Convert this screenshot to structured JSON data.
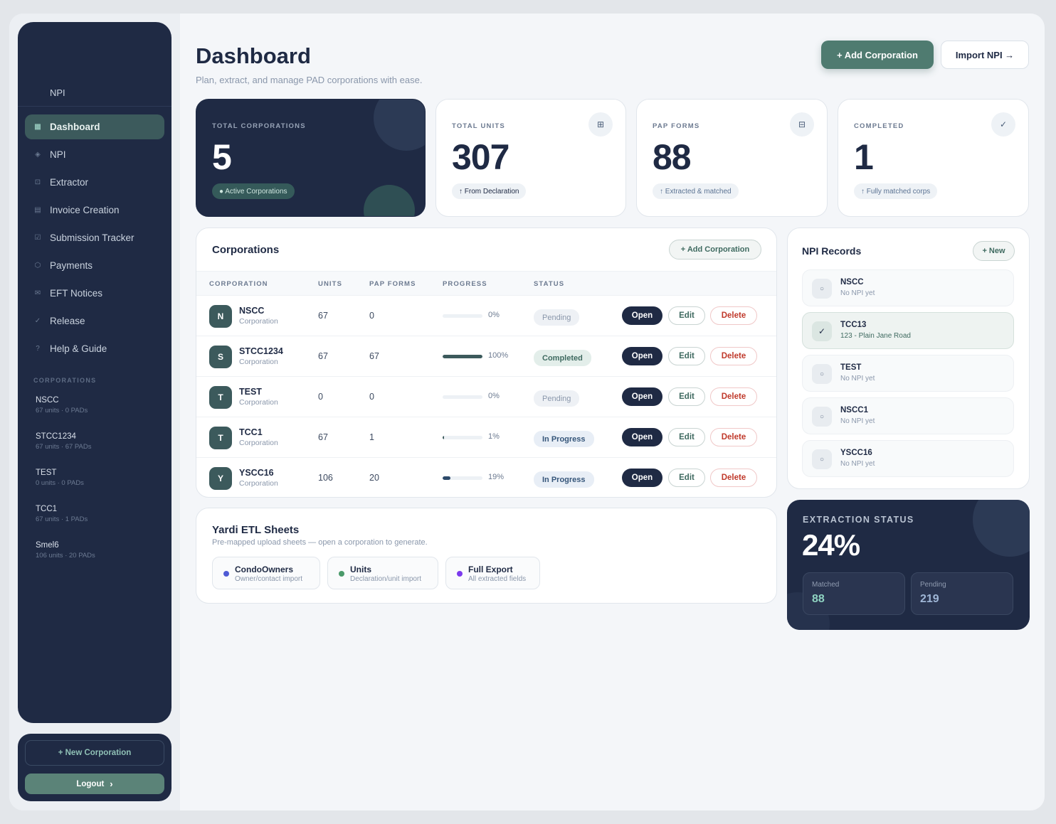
{
  "sidebar": {
    "brand": "NPI",
    "nav": [
      {
        "icon": "▦",
        "label": "Dashboard",
        "active": true
      },
      {
        "icon": "◈",
        "label": "NPI"
      },
      {
        "icon": "⊡",
        "label": "Extractor"
      },
      {
        "icon": "▤",
        "label": "Invoice Creation"
      },
      {
        "icon": "☑",
        "label": "Submission Tracker"
      },
      {
        "icon": "⬡",
        "label": "Payments"
      },
      {
        "icon": "✉",
        "label": "EFT Notices"
      },
      {
        "icon": "✓",
        "label": "Release"
      },
      {
        "icon": "?",
        "label": "Help & Guide"
      }
    ],
    "section_label": "CORPORATIONS",
    "corporations": [
      {
        "name": "NSCC",
        "meta": "67 units · 0 PADs"
      },
      {
        "name": "STCC1234",
        "meta": "67 units · 67 PADs"
      },
      {
        "name": "TEST",
        "meta": "0 units · 0 PADs"
      },
      {
        "name": "TCC1",
        "meta": "67 units · 1 PADs"
      },
      {
        "name": "Smel6",
        "meta": "106 units · 20 PADs"
      }
    ],
    "new_corporation": "+ New Corporation",
    "logout": "Logout"
  },
  "header": {
    "title": "Dashboard",
    "subtitle": "Plan, extract, and manage PAD corporations with ease.",
    "add_corporation": "+ Add Corporation",
    "import_npi": "Import NPI →"
  },
  "stats": [
    {
      "label": "TOTAL CORPORATIONS",
      "value": "5",
      "pill": "● Active Corporations"
    },
    {
      "label": "TOTAL UNITS",
      "value": "307",
      "pill": "↑ From Declaration",
      "icon": "⊞"
    },
    {
      "label": "PAP FORMS",
      "value": "88",
      "pill": "↑ Extracted & matched",
      "icon": "⊟"
    },
    {
      "label": "COMPLETED",
      "value": "1",
      "pill": "↑ Fully matched corps",
      "icon": "✓"
    }
  ],
  "corporations_panel": {
    "title": "Corporations",
    "add_button": "+ Add Corporation",
    "columns": [
      "CORPORATION",
      "UNITS",
      "PAP FORMS",
      "PROGRESS",
      "STATUS"
    ],
    "rows": [
      {
        "initial": "N",
        "name": "NSCC",
        "type": "Corporation",
        "units": "67",
        "pap": "0",
        "progress": 0,
        "pct": "0%",
        "status": "Pending"
      },
      {
        "initial": "S",
        "name": "STCC1234",
        "type": "Corporation",
        "units": "67",
        "pap": "67",
        "progress": 100,
        "pct": "100%",
        "status": "Completed"
      },
      {
        "initial": "T",
        "name": "TEST",
        "type": "Corporation",
        "units": "0",
        "pap": "0",
        "progress": 0,
        "pct": "0%",
        "status": "Pending"
      },
      {
        "initial": "T",
        "name": "TCC1",
        "type": "Corporation",
        "units": "67",
        "pap": "1",
        "progress": 1,
        "pct": "1%",
        "status": "In Progress"
      },
      {
        "initial": "Y",
        "name": "YSCC16",
        "type": "Corporation",
        "units": "106",
        "pap": "20",
        "progress": 19,
        "pct": "19%",
        "status": "In Progress"
      }
    ],
    "actions": {
      "open": "Open",
      "edit": "Edit",
      "delete": "Delete"
    }
  },
  "etl": {
    "title": "Yardi ETL Sheets",
    "subtitle": "Pre-mapped upload sheets — open a corporation to generate.",
    "sheets": [
      {
        "name": "CondoOwners",
        "desc": "Owner/contact import",
        "color": "#4f5bd5"
      },
      {
        "name": "Units",
        "desc": "Declaration/unit import",
        "color": "#4a9a6a"
      },
      {
        "name": "Full Export",
        "desc": "All extracted fields",
        "color": "#7c3aed"
      }
    ]
  },
  "npi": {
    "title": "NPI Records",
    "new_button": "+ New",
    "records": [
      {
        "name": "NSCC",
        "sub": "No NPI yet",
        "icon": "○"
      },
      {
        "name": "TCC13",
        "sub": "123 - Plain Jane Road",
        "icon": "✓",
        "selected": true
      },
      {
        "name": "TEST",
        "sub": "No NPI yet",
        "icon": "○"
      },
      {
        "name": "NSCC1",
        "sub": "No NPI yet",
        "icon": "○"
      },
      {
        "name": "YSCC16",
        "sub": "No NPI yet",
        "icon": "○"
      }
    ]
  },
  "extraction": {
    "label": "EXTRACTION STATUS",
    "value": "24%",
    "matched_label": "Matched",
    "matched_value": "88",
    "pending_label": "Pending",
    "pending_value": "219",
    "colors": {
      "matched": "#8fd3c1",
      "pending": "#9fb6d6"
    }
  }
}
